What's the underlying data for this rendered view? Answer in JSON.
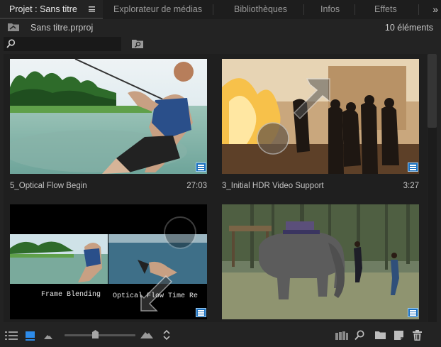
{
  "tabs": [
    {
      "label": "Projet : Sans titre",
      "active": true
    },
    {
      "label": "Explorateur de médias"
    },
    {
      "label": "Bibliothèques"
    },
    {
      "label": "Infos"
    },
    {
      "label": "Effets"
    }
  ],
  "more_icon": "»",
  "project": {
    "file": "Sans titre.prproj",
    "item_count": "10 éléments"
  },
  "search": {
    "value": "",
    "placeholder": ""
  },
  "clips": [
    {
      "name": "5_Optical Flow Begin",
      "duration": "27:03"
    },
    {
      "name": "3_Initial HDR Video Support",
      "duration": "3:27"
    },
    {
      "name": "",
      "duration": "",
      "overlay_texts": [
        "Frame Blending",
        "Optical Flow Time Re"
      ]
    },
    {
      "name": "",
      "duration": ""
    }
  ],
  "thumbnail_icons": [
    "waterski-thumbnail",
    "fire-performers-thumbnail",
    "frame-blending-comparison-thumbnail",
    "elephant-thumbnail"
  ],
  "zoom_level": 0.43,
  "colors": {
    "accent": "#2d8ceb",
    "panel_bg": "#232323",
    "tab_bar_bg": "#1d1d1d"
  }
}
